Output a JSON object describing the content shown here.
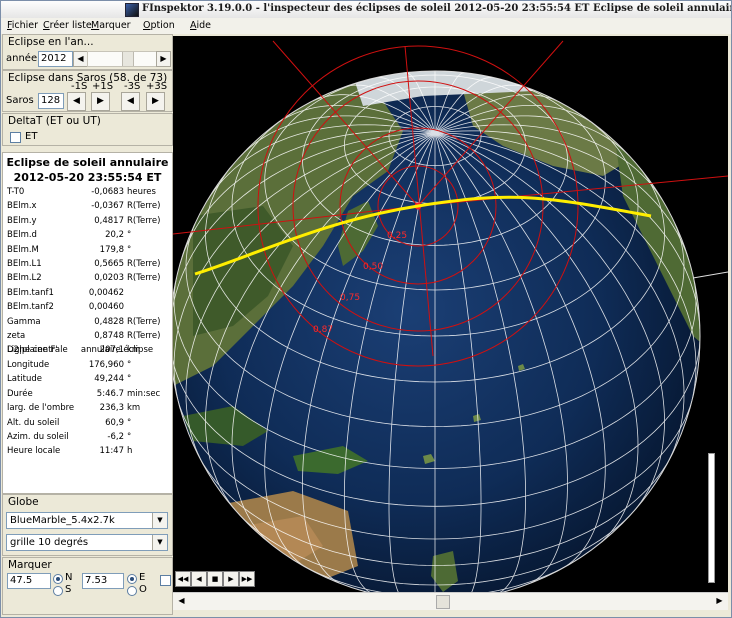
{
  "window": {
    "title": "FInspektor 3.19.0.0 - l'inspecteur des éclipses de soleil 2012-05-20  23:55:54 ET      Eclipse de soleil annulaire"
  },
  "menu": {
    "items": [
      {
        "label": "Fichier",
        "accel": "F"
      },
      {
        "label": "Créer liste",
        "accel": "C"
      },
      {
        "label": "Marquer",
        "accel": "M"
      },
      {
        "label": "Option",
        "accel": "O"
      },
      {
        "label": "Aide",
        "accel": "A"
      }
    ]
  },
  "eclipse_year": {
    "group_title": "Eclipse en l'an...",
    "label": "année",
    "value": "2012"
  },
  "saros": {
    "group_title": "Eclipse dans Saros (58. de 73)",
    "label": "Saros",
    "value": "128",
    "nav_labels": [
      "-1S",
      "+1S",
      "-3S",
      "+3S"
    ]
  },
  "deltat": {
    "group_title": "DeltaT (ET ou UT)",
    "checkbox_label": "ET",
    "checked": false
  },
  "info": {
    "title": "Eclipse de soleil annulaire",
    "datetime": "2012-05-20  23:55:54 ET",
    "rows": [
      {
        "key": "T-T0",
        "value": "-0,0683",
        "unit": "heures"
      },
      {
        "key": "BElm.x",
        "value": "-0,0367",
        "unit": "R(Terre)"
      },
      {
        "key": "BElm.y",
        "value": "0,4817",
        "unit": "R(Terre)"
      },
      {
        "key": "BElm.d",
        "value": "20,2",
        "unit": "°"
      },
      {
        "key": "BElm.M",
        "value": "179,8",
        "unit": "°"
      },
      {
        "key": "BElm.L1",
        "value": "0,5665",
        "unit": "R(Terre)"
      },
      {
        "key": "BElm.L2",
        "value": "0,0203",
        "unit": "R(Terre)"
      },
      {
        "key": "BElm.tanf1",
        "value": "0,00462",
        "unit": ""
      },
      {
        "key": "BElm.tanf2",
        "value": "0,00460",
        "unit": ""
      },
      {
        "key": "Gamma",
        "value": "0,4828",
        "unit": "R(Terre)"
      },
      {
        "key": "zeta",
        "value": "0,8748",
        "unit": "R(Terre)"
      },
      {
        "key": "D2|plaine F'",
        "value": "207,1",
        "unit": "km"
      }
    ],
    "central_line_label": "Ligne centrale",
    "central_line_value": "annulaire éclipse",
    "rows2": [
      {
        "key": "Longitude",
        "value": "176,960",
        "unit": "°"
      },
      {
        "key": "Latitude",
        "value": "49,244",
        "unit": "°"
      },
      {
        "key": "Durée",
        "value": "5:46.7",
        "unit": "min:sec"
      },
      {
        "key": "larg. de l'ombre",
        "value": "236,3",
        "unit": "km"
      },
      {
        "key": "Alt. du soleil",
        "value": "60,9",
        "unit": "°"
      },
      {
        "key": "Azim. du soleil",
        "value": "-6,2",
        "unit": "°"
      },
      {
        "key": "Heure locale",
        "value": "11:47",
        "unit": "h"
      }
    ]
  },
  "globe": {
    "group_title": "Globe",
    "texture": "BlueMarble_5.4x2.7k",
    "grid": "grille 10 degrés",
    "contour_labels": [
      "0,25",
      "0,50",
      "0,75",
      "0,87"
    ]
  },
  "marker": {
    "group_title": "Marquer",
    "lat_value": "47.5",
    "lon_value": "7.53",
    "lat_options": [
      "N",
      "S"
    ],
    "lat_selected": "N",
    "lon_options": [
      "E",
      "O"
    ],
    "lon_selected": "E"
  },
  "playback": {
    "buttons": [
      "rewind-icon",
      "step-back-icon",
      "stop-icon",
      "play-icon",
      "fast-forward-icon"
    ]
  },
  "colors": {
    "accent_red": "#d01010",
    "path_yellow": "#ffee00",
    "grid_white": "#ffffff",
    "ocean": "#0e2a52"
  }
}
